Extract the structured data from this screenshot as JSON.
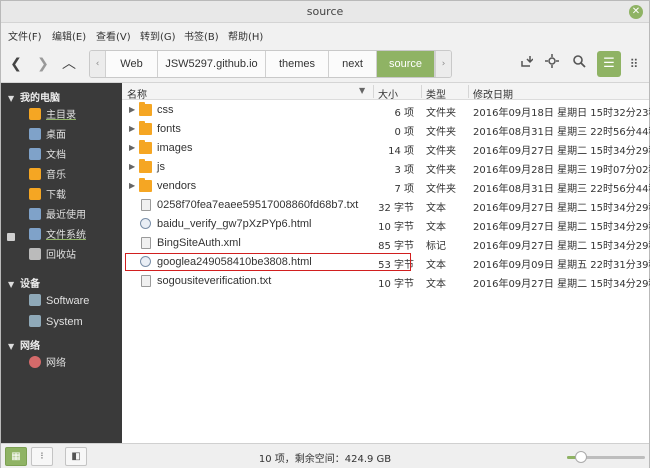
{
  "window": {
    "title": "source",
    "close_glyph": "✕"
  },
  "menubar": {
    "items": [
      "文件(F)",
      "编辑(E)",
      "查看(V)",
      "转到(G)",
      "书签(B)",
      "帮助(H)"
    ]
  },
  "toolbar": {
    "back_glyph": "❮",
    "forward_glyph": "❯",
    "up_glyph": "︿",
    "breadcrumbs": [
      "Web",
      "JSW5297.github.io",
      "themes",
      "next",
      "source"
    ],
    "path_left_glyph": "‹",
    "path_right_glyph": "›",
    "action_icons": [
      "open-terminal-icon",
      "location-pin-icon",
      "search-icon"
    ],
    "list_view_glyph": "☰",
    "grid_view_glyph": "⠿",
    "accent": "#8fb364"
  },
  "sidebar": {
    "sections": [
      {
        "header": "我的电脑",
        "items": [
          "主目录",
          "桌面",
          "文档",
          "音乐",
          "下载",
          "最近使用",
          "文件系统",
          "回收站"
        ]
      },
      {
        "header": "设备",
        "items": [
          "Software",
          "System"
        ]
      },
      {
        "header": "网络",
        "items": [
          "网络"
        ]
      }
    ]
  },
  "filelist": {
    "columns": {
      "name": "名称",
      "size": "大小",
      "type": "类型",
      "modified": "修改日期"
    },
    "rows": [
      {
        "name": "css",
        "size": "6 项",
        "type": "文件夹",
        "modified": "2016年09月18日 星期日 15时32分23秒",
        "kind": "folder"
      },
      {
        "name": "fonts",
        "size": "0 项",
        "type": "文件夹",
        "modified": "2016年08月31日 星期三 22时56分44秒",
        "kind": "folder"
      },
      {
        "name": "images",
        "size": "14 项",
        "type": "文件夹",
        "modified": "2016年09月27日 星期二 15时34分29秒",
        "kind": "folder"
      },
      {
        "name": "js",
        "size": "3 项",
        "type": "文件夹",
        "modified": "2016年09月28日 星期三 19时07分02秒",
        "kind": "folder"
      },
      {
        "name": "vendors",
        "size": "7 项",
        "type": "文件夹",
        "modified": "2016年08月31日 星期三 22时56分44秒",
        "kind": "folder"
      },
      {
        "name": "0258f70fea7eaee59517008860fd68b7.txt",
        "size": "32 字节",
        "type": "文本",
        "modified": "2016年09月27日 星期二 15时34分29秒",
        "kind": "text"
      },
      {
        "name": "baidu_verify_gw7pXzPYp6.html",
        "size": "10 字节",
        "type": "文本",
        "modified": "2016年09月27日 星期二 15时34分29秒",
        "kind": "html"
      },
      {
        "name": "BingSiteAuth.xml",
        "size": "85 字节",
        "type": "标记",
        "modified": "2016年09月27日 星期二 15时34分29秒",
        "kind": "text"
      },
      {
        "name": "googlea249058410be3808.html",
        "size": "53 字节",
        "type": "文本",
        "modified": "2016年09月09日 星期五 22时31分39秒",
        "kind": "html"
      },
      {
        "name": "sogousiteverification.txt",
        "size": "10 字节",
        "type": "文本",
        "modified": "2016年09月27日 星期二 15时34分29秒",
        "kind": "text"
      }
    ]
  },
  "statusbar": {
    "text": "10 项，剩余空间：424.9 GB",
    "places_glyph": "▦",
    "tree_glyph": "⁝",
    "toggle_glyph": "◧",
    "zoom_level": 0.18
  }
}
